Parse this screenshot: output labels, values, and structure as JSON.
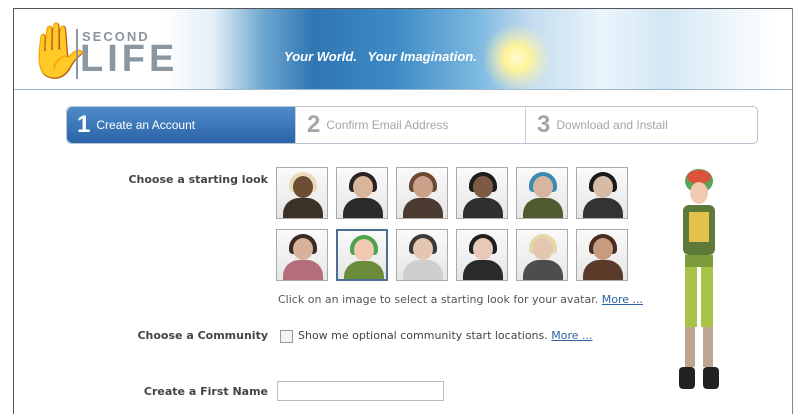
{
  "header": {
    "logo_second": "SECOND",
    "logo_life": "LIFE",
    "tagline": "Your World.   Your Imagination."
  },
  "steps": [
    {
      "num": "1",
      "label": "Create an Account",
      "active": true
    },
    {
      "num": "2",
      "label": "Confirm Email Address",
      "active": false
    },
    {
      "num": "3",
      "label": "Download and Install",
      "active": false
    }
  ],
  "form": {
    "starting_look_label": "Choose a starting look",
    "starting_look_hint": "Click on an image to select a starting look for your avatar.",
    "starting_look_more": "More ...",
    "selected_look_index": 7,
    "community_label": "Choose a Community",
    "community_checkbox_text": "Show me optional community start locations.",
    "community_more": "More ...",
    "community_checked": false,
    "first_name_label": "Create a First Name",
    "first_name_value": ""
  },
  "colors": {
    "accent": "#2a64a8",
    "link": "#2d62a4",
    "inactive_step": "#a6a6a6"
  }
}
